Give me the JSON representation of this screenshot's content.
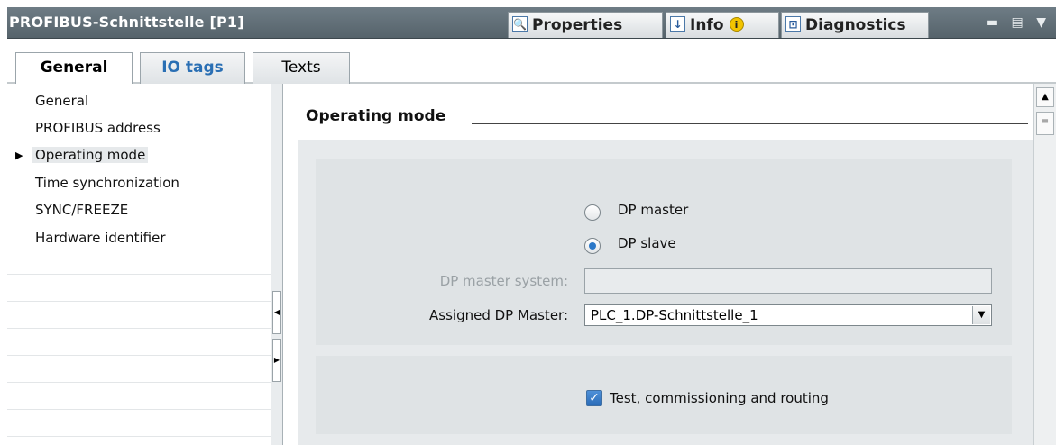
{
  "window": {
    "title": "PROFIBUS-Schnittstelle [P1]",
    "tabs": {
      "properties": "Properties",
      "info": "Info",
      "diagnostics": "Diagnostics"
    },
    "controls": "▬ ▤ ▼"
  },
  "subtabs": [
    {
      "label": "General"
    },
    {
      "label": "IO tags"
    },
    {
      "label": "Texts"
    }
  ],
  "nav": {
    "items": [
      {
        "label": "General"
      },
      {
        "label": "PROFIBUS address"
      },
      {
        "label": "Operating mode",
        "selected": true
      },
      {
        "label": "Time synchronization"
      },
      {
        "label": "SYNC/FREEZE"
      },
      {
        "label": "Hardware identifier"
      }
    ]
  },
  "main": {
    "heading": "Operating mode",
    "mode_options": [
      {
        "label": "DP master",
        "selected": false
      },
      {
        "label": "DP slave",
        "selected": true
      }
    ],
    "dp_master_system": {
      "label": "DP master system:",
      "value": ""
    },
    "assigned_master": {
      "label": "Assigned DP Master:",
      "value": "PLC_1.DP-Schnittstelle_1"
    },
    "test_commissioning": {
      "label": "Test, commissioning and routing",
      "checked": true
    }
  },
  "colors": {
    "titlebar": "#5f6c74",
    "accent": "#2b78c8",
    "tab_link": "#2a6fb4"
  }
}
